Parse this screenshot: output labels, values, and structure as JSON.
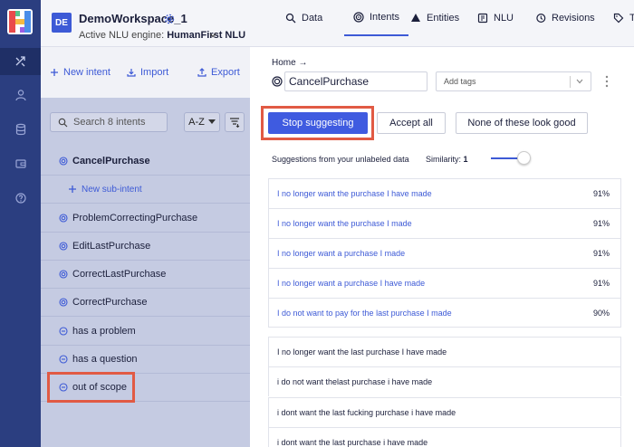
{
  "workspace": {
    "avatar_initials": "DE",
    "name": "DemoWorkspace_1",
    "engine_label": "Active NLU engine:",
    "engine_name": "HumanFirst NLU"
  },
  "nav_tabs": [
    {
      "label": "Data",
      "icon": "search-icon"
    },
    {
      "label": "Intents",
      "icon": "target-icon",
      "active": true
    },
    {
      "label": "Entities",
      "icon": "entities-icon"
    },
    {
      "label": "NLU",
      "icon": "nlu-icon"
    },
    {
      "label": "Revisions",
      "icon": "history-icon"
    },
    {
      "label": "Ta",
      "icon": "tag-icon"
    }
  ],
  "sidebar": {
    "actions": {
      "new_intent": "New intent",
      "import": "Import",
      "export": "Export"
    },
    "search_placeholder": "Search 8 intents",
    "sort_label": "A-Z",
    "intents": [
      {
        "label": "CancelPurchase",
        "bold": true
      },
      {
        "label": "New sub-intent",
        "sub": true
      },
      {
        "label": "ProblemCorrectingPurchase"
      },
      {
        "label": "EditLastPurchase"
      },
      {
        "label": "CorrectLastPurchase"
      },
      {
        "label": "CorrectPurchase"
      },
      {
        "label": "has a problem"
      },
      {
        "label": "has a question"
      },
      {
        "label": "out of scope"
      }
    ]
  },
  "main": {
    "breadcrumb": "Home  →",
    "intent_name": "CancelPurchase",
    "tags_placeholder": "Add tags",
    "buttons": {
      "stop": "Stop suggesting",
      "accept": "Accept all",
      "none": "None of these look good"
    },
    "suggestions_label": "Suggestions from your unlabeled data",
    "similarity_label": "Similarity:",
    "similarity_value": "1",
    "top_suggestions": [
      {
        "text": "I no longer want the purchase I have made",
        "pct": "91%"
      },
      {
        "text": "I no longer want the purchase I made",
        "pct": "91%"
      },
      {
        "text": "I no longer want a purchase I made",
        "pct": "91%"
      },
      {
        "text": "I no longer want a purchase I have made",
        "pct": "91%"
      },
      {
        "text": "I do not want to pay for the last purchase I made",
        "pct": "90%"
      }
    ],
    "other_suggestions": [
      {
        "text": "I no longer want the last purchase I have made"
      },
      {
        "text": "i do not want thelast purchase i have made"
      },
      {
        "text": "i dont want the last fucking purchase i have made"
      },
      {
        "text": "i dont want the last purchase i have made"
      }
    ]
  },
  "colors": {
    "accent": "#3d5ad6",
    "rail": "#2b3e80",
    "highlight": "#e15a44"
  }
}
